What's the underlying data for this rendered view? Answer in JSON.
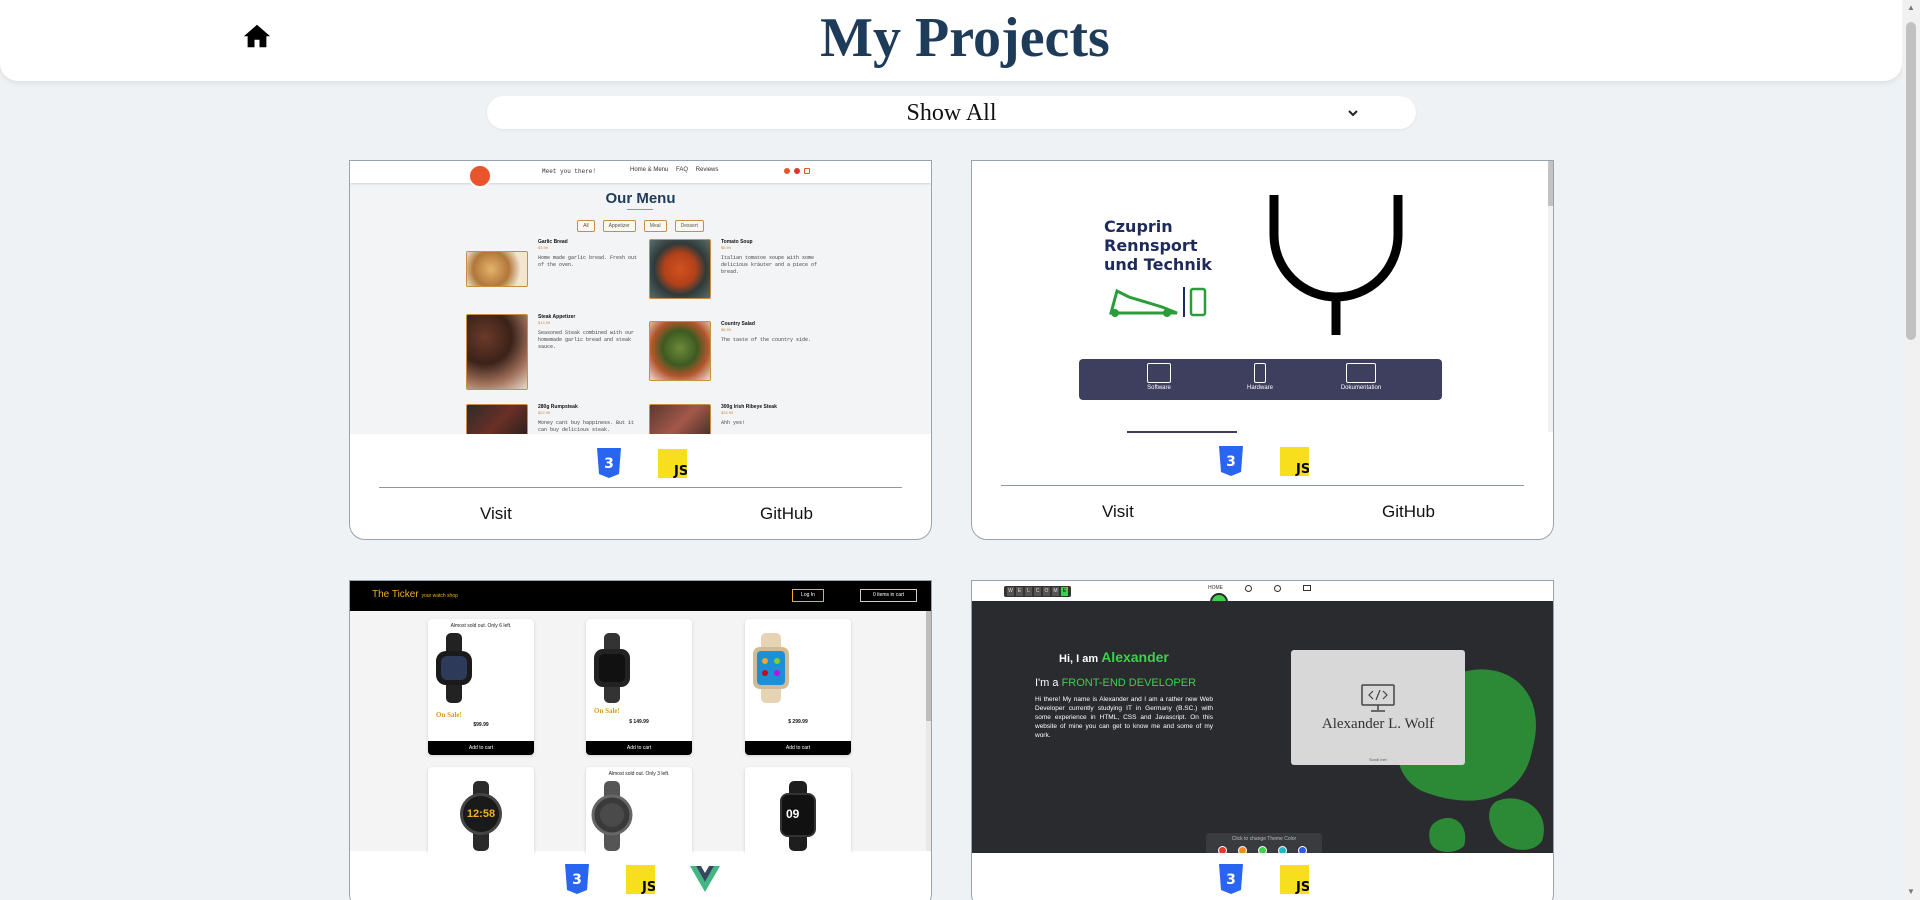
{
  "header": {
    "title": "My Projects",
    "home_icon": "home-icon"
  },
  "filter": {
    "selected": "Show All",
    "icon": "chevron-down-icon"
  },
  "projects": [
    {
      "preview": {
        "tagline": "Meet you there!",
        "nav_links": [
          "Home & Menu",
          "FAQ",
          "Reviews"
        ],
        "section_title": "Our Menu",
        "filters": [
          "All",
          "Appetizer",
          "Meal",
          "Dessert"
        ],
        "items": [
          {
            "name": "Garlic Bread",
            "price": "$3.99",
            "desc": "Home made garlic bread. Fresh out of the oven."
          },
          {
            "name": "Tomato Soup",
            "price": "$5.99",
            "desc": "Italian tomatoe soupe with some delicious kräuter and a piece of bread."
          },
          {
            "name": "Steak Appetizer",
            "price": "$14.99",
            "desc": "Seasoned Steak combined with our homemade garlic bread and steak sauce."
          },
          {
            "name": "Country Salad",
            "price": "$6.99",
            "desc": "The taste of the country side."
          },
          {
            "name": "280g Rumpsteak",
            "price": "$22.99",
            "desc": "Money cant buy happiness. But it can buy delicious steak."
          },
          {
            "name": "300g Irish Ribeye Steak",
            "price": "$26.99",
            "desc": "Ahh yes!"
          }
        ]
      },
      "tech": [
        "css3-icon",
        "javascript-icon"
      ],
      "visit_label": "Visit",
      "github_label": "GitHub"
    },
    {
      "preview": {
        "title_lines": [
          "Czuprin",
          "Rennsport",
          "und Technik"
        ],
        "buttons": [
          "Software",
          "Hardware",
          "Dokumentation"
        ]
      },
      "tech": [
        "css3-icon",
        "javascript-icon"
      ],
      "visit_label": "Visit",
      "github_label": "GitHub"
    },
    {
      "preview": {
        "brand": "The Ticker",
        "brand_sub": "your watch shop",
        "login": "Log In",
        "cart": "0 items in cart",
        "products": [
          {
            "note": "Almost sold out. Only 6 left.",
            "sale": "On Sale!",
            "price": "$99.99",
            "button": "Add to cart"
          },
          {
            "note": "",
            "sale": "On Sale!",
            "price": "$ 149.99",
            "button": "Add to cart"
          },
          {
            "note": "",
            "sale": "",
            "price": "$ 299.99",
            "button": "Add to cart"
          },
          {
            "note": "",
            "sale": "",
            "price": "",
            "button": ""
          },
          {
            "note": "Almost sold out. Only 3 left.",
            "sale": "",
            "price": "",
            "button": ""
          },
          {
            "note": "",
            "sale": "",
            "price": "",
            "button": ""
          }
        ],
        "watch_time_1": "12:58",
        "watch_time_2": "09"
      },
      "tech": [
        "css3-icon",
        "javascript-icon",
        "vue-icon"
      ]
    },
    {
      "preview": {
        "letters": [
          "W",
          "E",
          "L",
          "C",
          "O",
          "M",
          "E"
        ],
        "nav_items": [
          "HOME",
          "",
          "",
          ""
        ],
        "greeting": "Hi, I am",
        "name": "Alexander",
        "role_prefix": "I'm a",
        "role": "FRONT-END DEVELOPER",
        "intro": "Hi there! My name is Alexander and I am a rather new Web Developer currently studying IT in Germany (B.SC.) with some experience in HTML, CSS and Javascript. On this website of mine you can get to know me and some of my work.",
        "card_name": "Alexander L. Wolf",
        "card_small": "Scroll me!",
        "theme_label": "Click to change Theme Color",
        "swatches": [
          "#e03a2f",
          "#f08a1e",
          "#3ecf4c",
          "#22b5c9",
          "#2d5be0"
        ]
      },
      "tech": [
        "css3-icon",
        "javascript-icon"
      ]
    }
  ],
  "colors": {
    "title": "#1f3b5a",
    "css3": "#2965f1",
    "javascript": "#f7df1e",
    "vue": "#41b883",
    "accent_green": "#3ecf4c",
    "menu_gold": "#c6903f",
    "ticker_gold": "#f2b01e"
  }
}
